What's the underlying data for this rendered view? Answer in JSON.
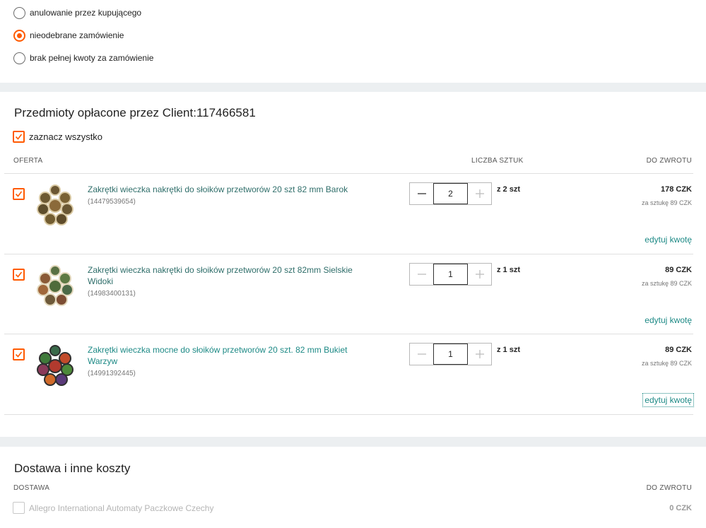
{
  "reasons": [
    {
      "label": "anulowanie przez kupującego",
      "selected": false
    },
    {
      "label": "nieodebrane zamówienie",
      "selected": true
    },
    {
      "label": "brak pełnej kwoty za zamówienie",
      "selected": false
    }
  ],
  "items_section": {
    "title": "Przedmioty opłacone przez Client:117466581",
    "select_all": "zaznacz wszystko",
    "col_offer": "OFERTA",
    "col_quantity": "LICZBA SZTUK",
    "col_refund": "DO ZWROTU"
  },
  "items": [
    {
      "title": "Zakrętki wieczka nakrętki do słoików przetworów 20 szt 82 mm Barok",
      "id": "(14479539654)",
      "qty": "2",
      "of_qty": "z 2 szt",
      "amount": "178 CZK",
      "per_unit": "za sztukę 89 CZK",
      "edit": "edytuj kwotę"
    },
    {
      "title": "Zakrętki wieczka nakrętki do słoików przetworów 20 szt 82mm Sielskie Widoki",
      "id": "(14983400131)",
      "qty": "1",
      "of_qty": "z 1 szt",
      "amount": "89 CZK",
      "per_unit": "za sztukę 89 CZK",
      "edit": "edytuj kwotę"
    },
    {
      "title": "Zakrętki wieczka mocne do słoików przetworów 20 szt. 82 mm Bukiet Warzyw",
      "id": "(14991392445)",
      "qty": "1",
      "of_qty": "z 1 szt",
      "amount": "89 CZK",
      "per_unit": "za sztukę 89 CZK",
      "edit": "edytuj kwotę"
    }
  ],
  "delivery_section": {
    "title": "Dostawa i inne koszty",
    "col_delivery": "DOSTAWA",
    "col_refund": "DO ZWROTU",
    "method": "Allegro International Automaty Paczkowe Czechy",
    "amount": "0 CZK"
  },
  "colors": {
    "accent": "#ff5a00",
    "link": "#1e8a86",
    "background": "#eceff1"
  }
}
